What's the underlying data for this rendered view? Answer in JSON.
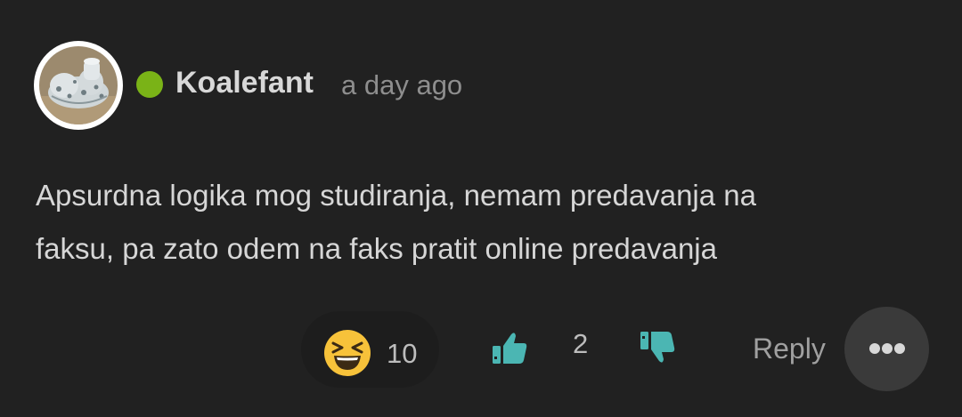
{
  "comment": {
    "author": "Koalefant",
    "timestamp": "a day ago",
    "online_status_color": "#7ab317",
    "body_line1": "Apsurdna logika mog studiranja, nemam predavanja na",
    "body_line2": "faksu, pa zato odem na faks pratit online predavanja",
    "reaction": {
      "icon": "laughing-emoji-icon",
      "count": "10"
    },
    "likes": {
      "icon": "thumbs-up-icon",
      "count": "2",
      "color": "#4bb6b3"
    },
    "dislikes": {
      "icon": "thumbs-down-icon",
      "color": "#4bb6b3"
    },
    "reply_label": "Reply",
    "more_icon": "more-options-icon"
  }
}
